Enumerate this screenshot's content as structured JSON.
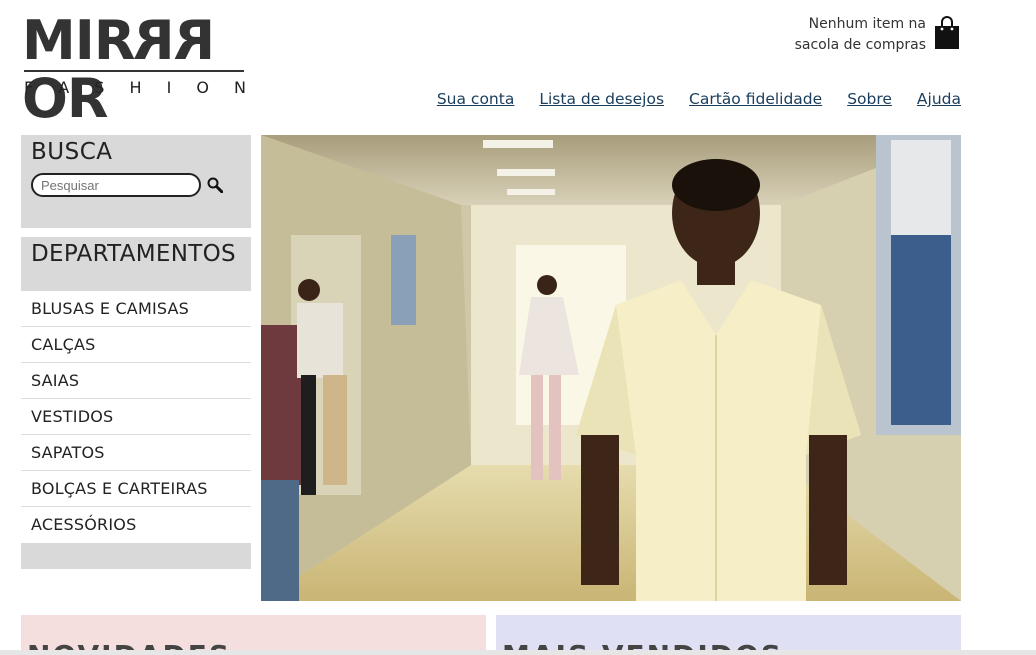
{
  "logo": {
    "main_a": "MIR",
    "main_rev": "RR",
    "main_b": "OR",
    "sub": [
      "F",
      "A",
      "S",
      "H",
      "I",
      "O",
      "N"
    ]
  },
  "cart": {
    "line1": "Nenhum item na",
    "line2": "sacola de compras",
    "icon": "shopping-bag-icon"
  },
  "topnav": [
    "Sua conta",
    "Lista de desejos",
    "Cartão fidelidade",
    "Sobre",
    "Ajuda"
  ],
  "search": {
    "title": "BUSCA",
    "placeholder": "Pesquisar",
    "icon": "search-icon"
  },
  "departments": {
    "title": "DEPARTAMENTOS",
    "items": [
      "BLUSAS E CAMISAS",
      "CALÇAS",
      "SAIAS",
      "VESTIDOS",
      "SAPATOS",
      "BOLÇAS E CARTEIRAS",
      "ACESSÓRIOS"
    ]
  },
  "panels": {
    "new_title": "NOVIDADES",
    "best_title": "MAIS VENDIDOS"
  },
  "colors": {
    "sidebar_bg": "#d9d9d9",
    "link": "#1a3d5c",
    "panel_new": "#f4dede",
    "panel_best": "#e0e0f4"
  }
}
